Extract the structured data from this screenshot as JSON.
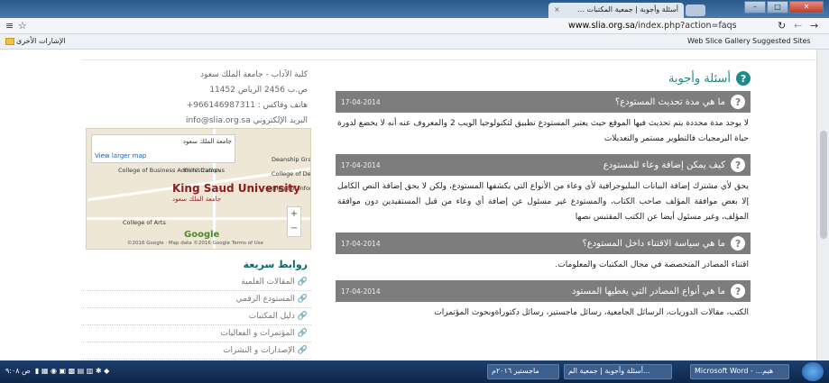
{
  "browser": {
    "tab_title": "أسئلة وأجوبة | جمعية المكتبات ...",
    "url_domain": "www.slia.org.sa",
    "url_path": "/index.php?action=faqs",
    "bookmarks": {
      "other": "الإشارات الأخرى",
      "web_slice": "Web Slice Gallery",
      "suggested": "Suggested Sites"
    }
  },
  "page": {
    "title": "أسئلة وأجوبة",
    "faqs": [
      {
        "question": "ما هي مدة تحديث المستودع؟",
        "date": "17-04-2014",
        "answer": "لا يوجد مدة محددة يتم تحديث فيها الموقع حيث يعتبر المستودع تطبيق لتكنولوجيا الويب 2 والمعروف عنه أنه لا يخضع لدورة حياة البرمجيات فالتطوير مستمر والتعديلات"
      },
      {
        "question": "كيف يمكن إضافة وعاء للمستودع",
        "date": "17-04-2014",
        "answer": "يحق لأي مشترك إضافة البيانات الببليوجرافية لأي وعاء من الأنواع التي يكشفها المستودع، ولكن لا يحق إضافة النص الكامل إلا بعض موافقة المؤلف صاحب الكتاب، والمستودع غير مسئول عن إضافة أي وعاء من قبل المستفيدين دون موافقة المؤلف، وغير مسئول أيضا عن الكتب المقتبس نصها"
      },
      {
        "question": "ما هي سياسة الاقتناء داخل المستودع؟",
        "date": "17-04-2014",
        "answer": "اقتناء المصادر المتخصصة في مجال المكتبات والمعلومات."
      },
      {
        "question": "ما هي أنواع المصادر التي يغطيها المستود",
        "date": "17-04-2014",
        "answer": "الكتب، مقالات الدوريات، الرسائل الجامعية، رسائل ماجستير، رسائل دكتوراةوبحوث المؤتمرات"
      }
    ]
  },
  "sidebar": {
    "contact": [
      "كلية الآداب - جامعة الملك سعود",
      "ص.ب 2456 الرياض 11452",
      "هاتف وفاكس : 966146987311+",
      "البريد الإلكتروني info@slia.org.sa"
    ],
    "map": {
      "place": "جامعة الملك سعود",
      "view_larger": "View larger map",
      "labels": [
        "College of Business Administration",
        "Girls' Campus",
        "College of Dentistry",
        "Deanship Graduate",
        "College of Information",
        "College of Arts",
        "Google"
      ],
      "university_en": "King Saud University",
      "university_ar": "جامعة الملك سعود",
      "footer": "©2016 Google · Map data ©2016 Google   Terms of Use"
    },
    "quick_links_title": "روابط سريعة",
    "quick_links": [
      "المقالات العلمية",
      "المستودع الرقمي",
      "دليل المكتبات",
      "المؤتمرات و الفعاليات",
      "الإصدارات و النشرات"
    ]
  },
  "taskbar": {
    "tray_time": "ص ٩:٠٨",
    "tasks": [
      "ماجستير ٢٠١٦م",
      "أسئلة وأجوبة | جمعية الم...",
      "Microsoft Word - ...هيم"
    ]
  }
}
